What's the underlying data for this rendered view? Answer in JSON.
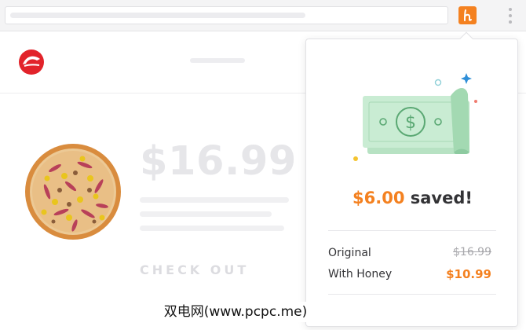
{
  "browser": {
    "extension_icon": "honey-h-icon",
    "menu_icon": "kebab-menu-icon"
  },
  "site": {
    "logo": "pizza-hut-logo",
    "product": {
      "image": "pizza-image",
      "price": "$16.99",
      "checkout_label": "CHECK OUT"
    }
  },
  "popup": {
    "illustration": "dollar-bill-icon",
    "saved_amount": "$6.00",
    "saved_suffix": "saved!",
    "rows": [
      {
        "label": "Original",
        "value": "$16.99"
      },
      {
        "label": "With Honey",
        "value": "$10.99"
      }
    ]
  },
  "watermark": "双电网(www.pcpc.me)",
  "colors": {
    "honey_orange": "#f48120",
    "bill_green": "#c9ecd3",
    "logo_red": "#e2232a"
  }
}
